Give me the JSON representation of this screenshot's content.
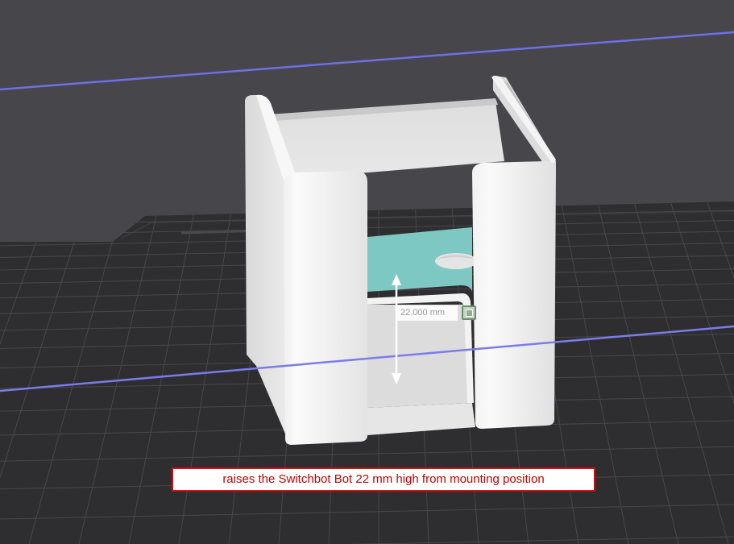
{
  "viewport": {
    "background_color": "#46464b",
    "bed_color": "#2e2e30",
    "grid_color": "#48484a",
    "axis_line_color": "#6f6fe6",
    "model_color": "#e9e9e9",
    "selected_face_color": "#7ec8c3"
  },
  "measurement": {
    "value": "22.000 mm",
    "handle_icon": "ruler-handle-icon"
  },
  "caption": {
    "text": "raises the Switchbot Bot 22 mm high from mounting position",
    "border_color": "#cc1010",
    "text_color": "#c40000"
  }
}
